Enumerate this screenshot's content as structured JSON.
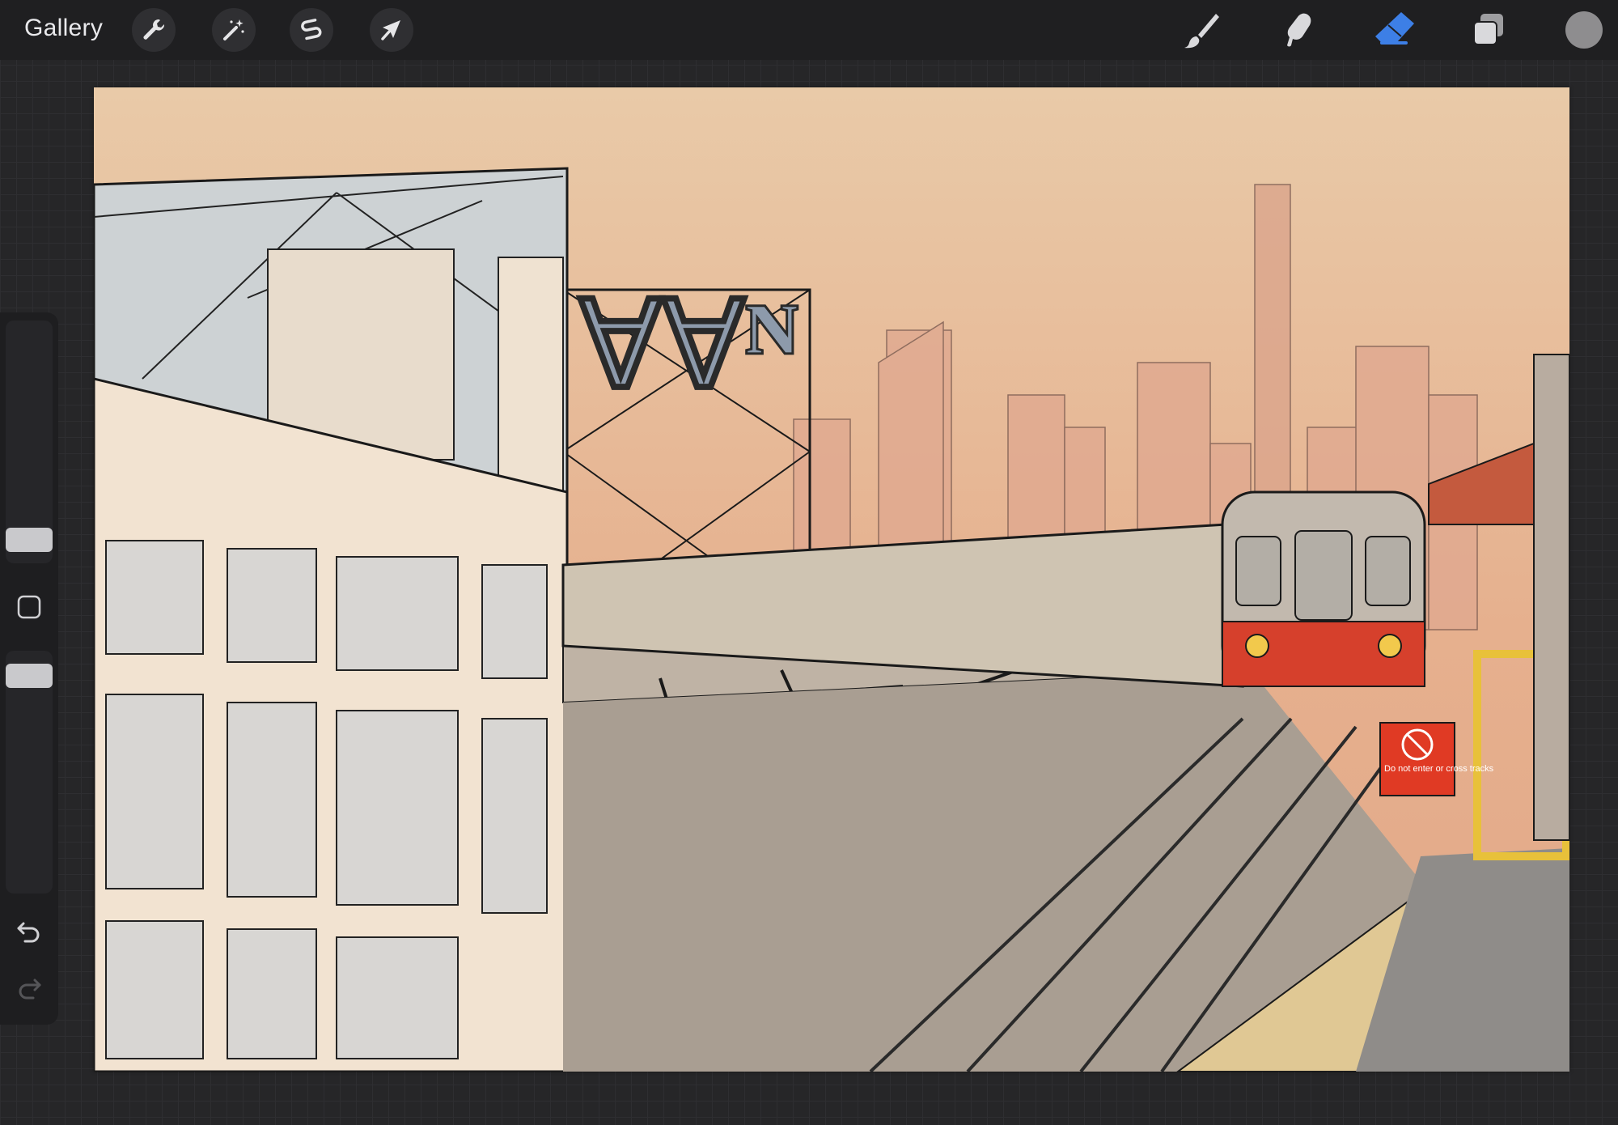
{
  "toolbar": {
    "gallery_label": "Gallery",
    "left_tools": [
      {
        "name": "actions",
        "icon": "wrench-icon"
      },
      {
        "name": "adjustments",
        "icon": "magic-wand-icon"
      },
      {
        "name": "selection",
        "icon": "selection-s-icon"
      },
      {
        "name": "transform",
        "icon": "arrow-cursor-icon"
      }
    ],
    "right_tools": [
      {
        "name": "brush",
        "icon": "brush-icon",
        "active": false
      },
      {
        "name": "smudge",
        "icon": "smudge-finger-icon",
        "active": false
      },
      {
        "name": "eraser",
        "icon": "eraser-icon",
        "active": true
      },
      {
        "name": "layers",
        "icon": "layers-icon",
        "active": false
      }
    ],
    "current_color": "#8e8d8f",
    "active_tool_color": "#3d7fe6"
  },
  "sidebar": {
    "brush_size_icon": "size-slider",
    "modify_icon": "square-icon",
    "opacity_icon": "opacity-slider",
    "undo_icon": "undo-arrow-icon",
    "redo_icon": "redo-arrow-icon"
  },
  "canvas": {
    "subject": "illustration",
    "sky_colors": [
      "#e9caa8",
      "#e6b08e"
    ],
    "billboard_text": "Ɐ∀ᴺ",
    "sign_text": "Do not enter or cross tracks",
    "sign_color": "#e03a24",
    "train_accent_color": "#d6402c"
  }
}
